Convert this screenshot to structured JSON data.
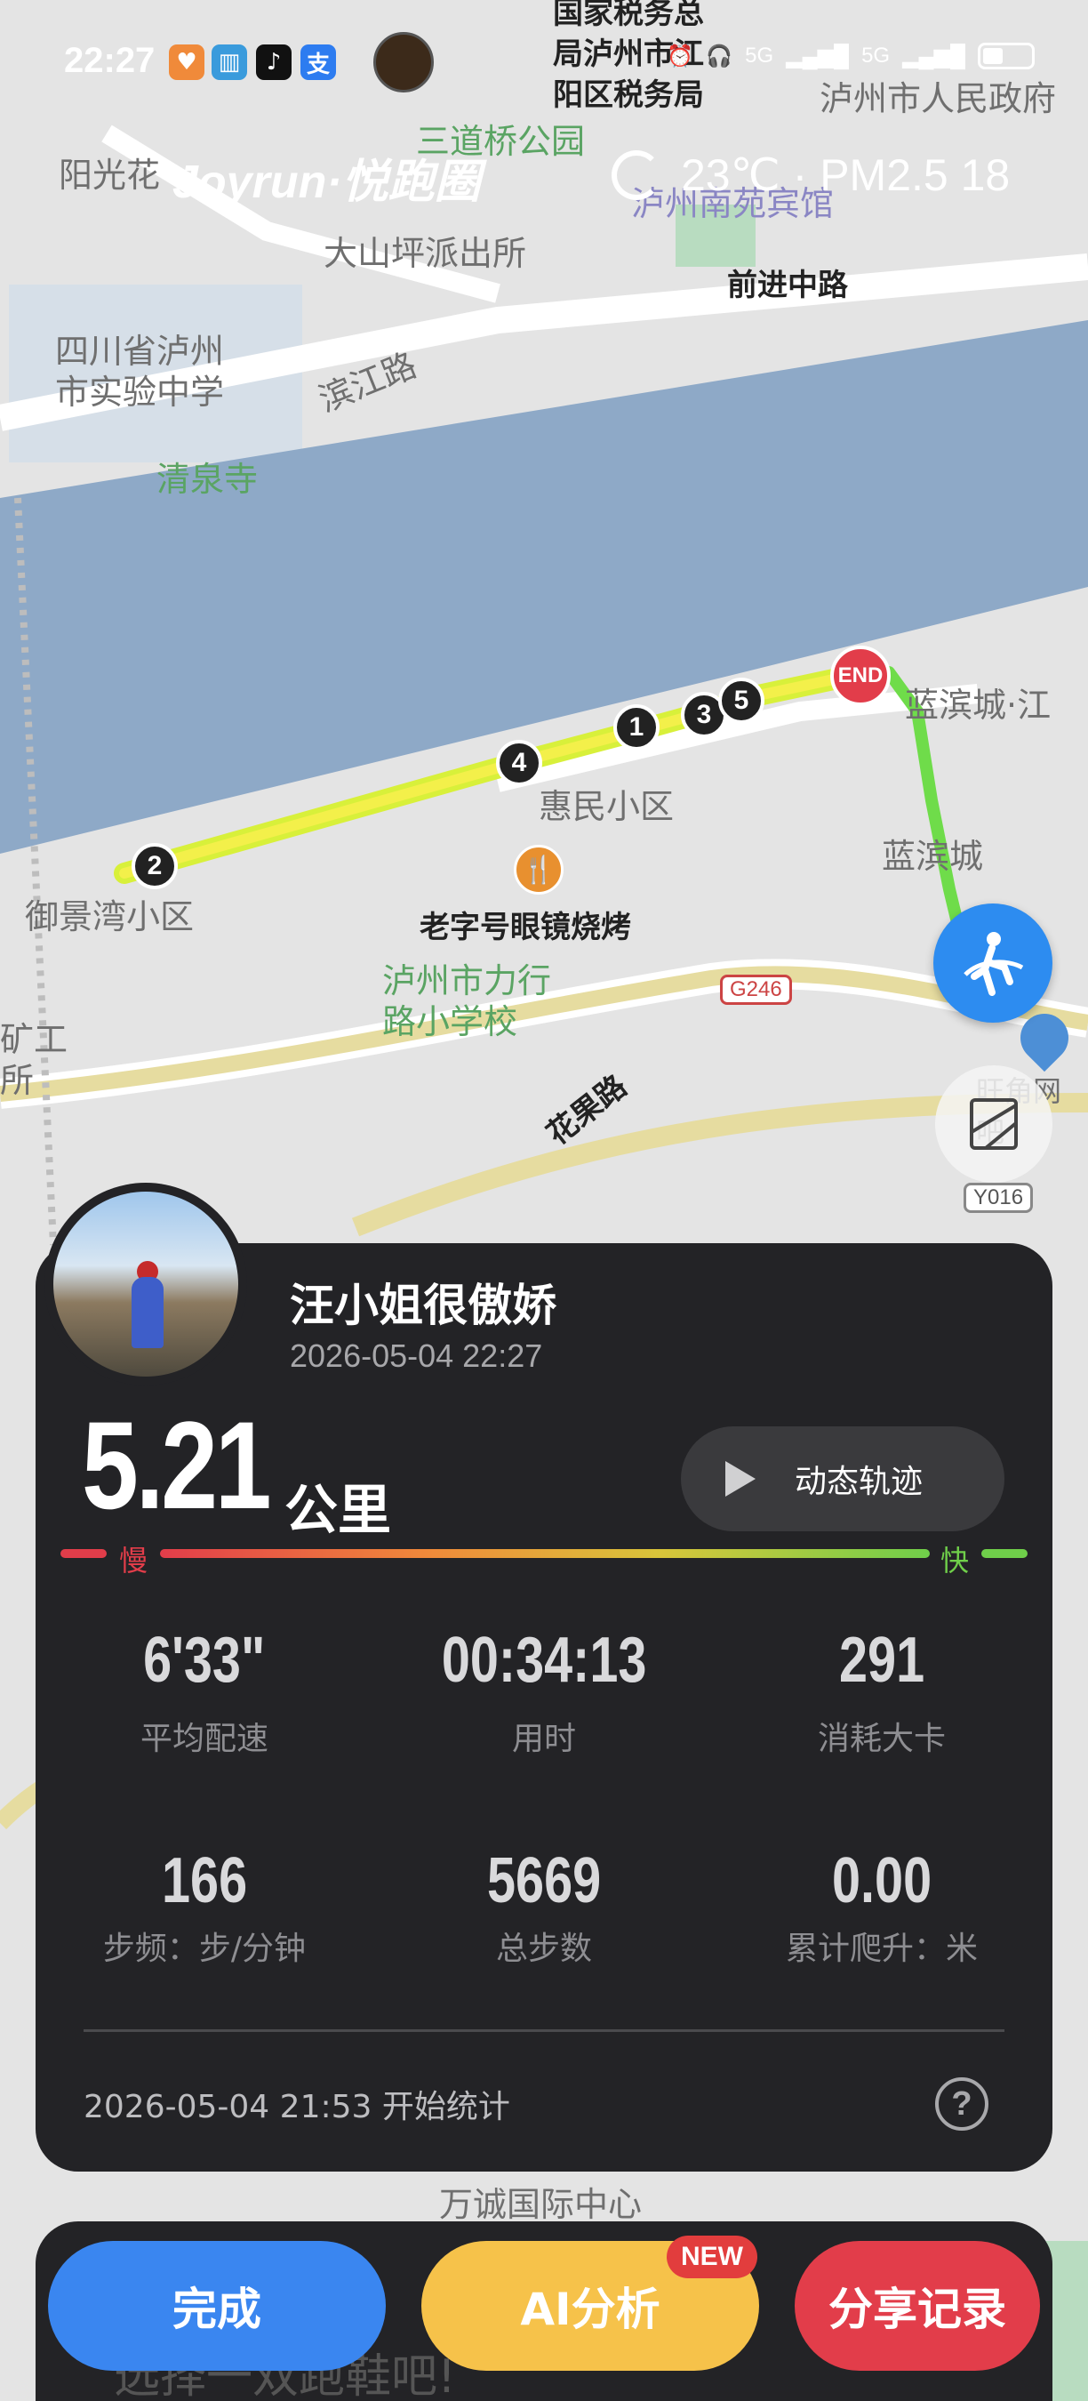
{
  "status_bar": {
    "time": "22:27",
    "network_1": "5G",
    "network_2": "5G"
  },
  "header": {
    "brand": "Joyrun·悦跑圈",
    "weather": "23℃ · PM2.5 18"
  },
  "map": {
    "labels": [
      {
        "text": "国家税务总\n局泸州市江\n阳区税务局",
        "style": "dark"
      },
      {
        "text": "泸州市人民政府",
        "style": "normal"
      },
      {
        "text": "三道桥公园",
        "style": "green"
      },
      {
        "text": "阳光花",
        "style": "normal"
      },
      {
        "text": "泸州南苑宾馆",
        "style": "purple"
      },
      {
        "text": "大山坪派出所",
        "style": "normal"
      },
      {
        "text": "前进中路",
        "style": "dark"
      },
      {
        "text": "四川省泸州\n市实验中学",
        "style": "normal"
      },
      {
        "text": "滨江路",
        "style": "normal"
      },
      {
        "text": "清泉寺",
        "style": "green"
      },
      {
        "text": "蓝滨城·江",
        "style": "normal"
      },
      {
        "text": "惠民小区",
        "style": "normal"
      },
      {
        "text": "蓝滨城",
        "style": "normal"
      },
      {
        "text": "御景湾小区",
        "style": "normal"
      },
      {
        "text": "老字号眼镜烧烤",
        "style": "dark"
      },
      {
        "text": "泸州市力行\n路小学校",
        "style": "green"
      },
      {
        "text": "花果路",
        "style": "dark"
      },
      {
        "text": "旺角网吧",
        "style": "normal"
      },
      {
        "text": "万诚国际中心",
        "style": "normal"
      },
      {
        "text": "矿工\n所",
        "style": "normal"
      }
    ],
    "road_signs": [
      "G246",
      "Y016"
    ],
    "end_label": "END",
    "km_markers": [
      "1",
      "2",
      "3",
      "4",
      "5"
    ]
  },
  "run": {
    "user_name": "汪小姐很傲娇",
    "date": "2026-05-04 22:27",
    "distance": "5.21",
    "distance_unit": "公里",
    "replay_label": "动态轨迹",
    "pace_slow": "慢",
    "pace_fast": "快",
    "stats": [
      {
        "value": "6'33\"",
        "label": "平均配速"
      },
      {
        "value": "00:34:13",
        "label": "用时"
      },
      {
        "value": "291",
        "label": "消耗大卡"
      },
      {
        "value": "166",
        "label": "步频：步/分钟"
      },
      {
        "value": "5669",
        "label": "总步数"
      },
      {
        "value": "0.00",
        "label": "累计爬升：米"
      }
    ],
    "start_time": "2026-05-04 21:53  开始统计",
    "help": "?"
  },
  "actions": {
    "done": "完成",
    "ai": "AI分析",
    "new_badge": "NEW",
    "share": "分享记录",
    "behind_text": "选择一双跑鞋吧!"
  }
}
